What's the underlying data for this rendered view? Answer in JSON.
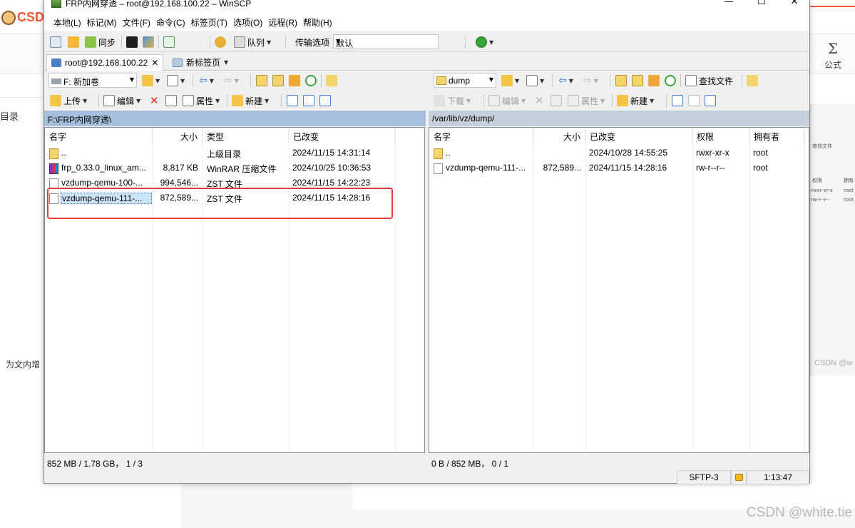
{
  "background": {
    "logo_text": "CSD",
    "catalog_text": "目录",
    "left_text": "为文内增",
    "formula_symbol": "Σ",
    "formula_label": "公式",
    "right_mini": [
      "查找文件",
      "权限",
      "拥有",
      "rwxr-xr-x",
      "root",
      "rw-r--r--",
      "root"
    ],
    "csdn_small": "CSDN @w",
    "watermark": "CSDN @white.tie"
  },
  "window": {
    "title": "FRP内网穿透 – root@192.168.100.22 – WinSCP",
    "controls": [
      "—",
      "☐",
      "✕"
    ]
  },
  "menu": [
    "本地(L)",
    "标记(M)",
    "文件(F)",
    "命令(C)",
    "标签页(T)",
    "选项(O)",
    "远程(R)",
    "帮助(H)"
  ],
  "toolbar": {
    "sync_label": "同步",
    "queue_label": "队列",
    "transfer_label": "传输选项",
    "transfer_value": "默认"
  },
  "tabs": {
    "session": "root@192.168.100.22",
    "new_tab": "新标签页"
  },
  "local": {
    "drive": "F: 新加卷",
    "upload": "上传",
    "edit": "编辑",
    "properties": "属性",
    "new": "新建",
    "path": "F:\\FRP内网穿透\\",
    "columns": [
      "名字",
      "大小",
      "类型",
      "已改变"
    ],
    "files": [
      {
        "name": "..",
        "size": "",
        "type": "上级目录",
        "changed": "2024/11/15 14:31:14",
        "icon": "up-folder-icon"
      },
      {
        "name": "frp_0.33.0_linux_am...",
        "size": "8,817 KB",
        "type": "WinRAR 压缩文件",
        "changed": "2024/10/25 10:36:53",
        "icon": "rar-archive-icon"
      },
      {
        "name": "vzdump-qemu-100-...",
        "size": "994,546...",
        "type": "ZST 文件",
        "changed": "2024/11/15 14:22:23",
        "icon": "file-icon"
      },
      {
        "name": "vzdump-qemu-111-...",
        "size": "872,589...",
        "type": "ZST 文件",
        "changed": "2024/11/15 14:28:16",
        "icon": "file-icon"
      }
    ],
    "status": "852 MB / 1.78 GB，  1 / 3"
  },
  "remote": {
    "dir": "dump",
    "find_files": "查找文件",
    "download": "下载",
    "edit": "编辑",
    "properties": "属性",
    "new": "新建",
    "path": "/var/lib/vz/dump/",
    "columns": [
      "名字",
      "大小",
      "已改变",
      "权限",
      "拥有者"
    ],
    "files": [
      {
        "name": "..",
        "size": "",
        "changed": "2024/10/28 14:55:25",
        "rights": "rwxr-xr-x",
        "owner": "root",
        "icon": "up-folder-icon"
      },
      {
        "name": "vzdump-qemu-111-...",
        "size": "872,589...",
        "changed": "2024/11/15 14:28:16",
        "rights": "rw-r--r--",
        "owner": "root",
        "icon": "file-icon"
      }
    ],
    "status": "0 B / 852 MB，  0 / 1"
  },
  "statusbar": {
    "protocol": "SFTP-3",
    "time": "1:13:47"
  },
  "colors": {
    "path_active": "#a6bfdc",
    "highlight": "#e23b3b",
    "csdn_red": "#fc5531"
  }
}
